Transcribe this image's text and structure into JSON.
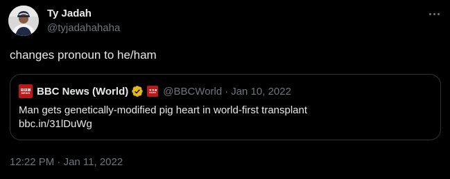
{
  "author": {
    "name": "Ty Jadah",
    "handle": "@tyjadahahaha"
  },
  "tweet": {
    "text": "changes pronoun to he/ham",
    "time": "12:22 PM",
    "date": "Jan 11, 2022",
    "separator": "·"
  },
  "quoted": {
    "logo_letters": [
      "B",
      "B",
      "C"
    ],
    "logo_subtext": "NEWS",
    "name": "BBC News (World)",
    "handle": "@BBCWorld",
    "separator": "·",
    "date": "Jan 10, 2022",
    "text": "Man gets genetically-modified pig heart in world-first transplant",
    "link": "bbc.in/31lDuWg"
  },
  "icons": {
    "more": "more-horizontal-icon",
    "verified": "verified-badge-icon",
    "affiliate": "bbc-affiliate-icon"
  },
  "colors": {
    "background": "#000000",
    "text_primary": "#e7e9ea",
    "text_secondary": "#71767b",
    "border": "#2f3336",
    "verified_gold": "#e2b719",
    "bbc_red": "#bb1919"
  }
}
